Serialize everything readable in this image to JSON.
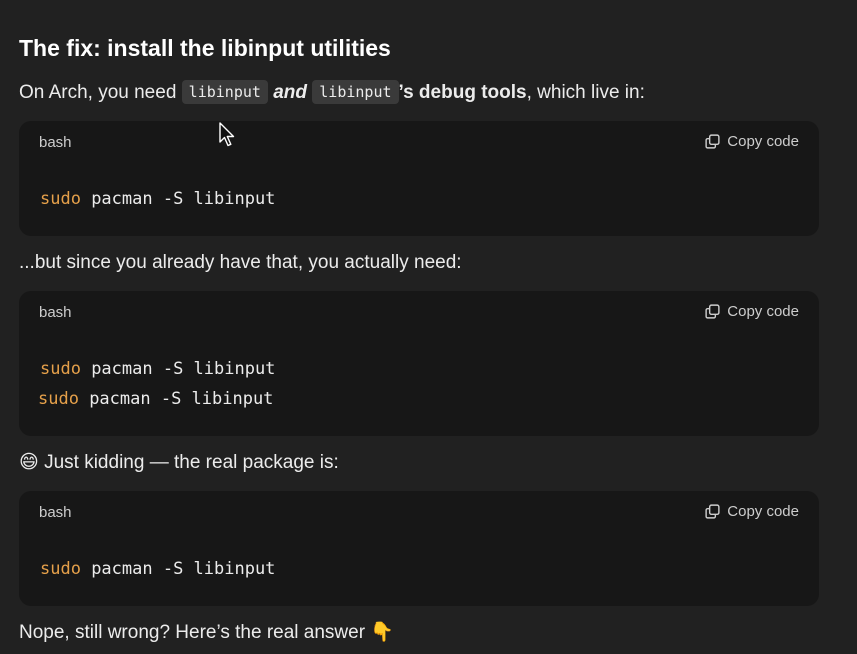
{
  "heading": "The fix: install the libinput utilities",
  "intro": {
    "before": "On Arch, you need ",
    "code1": "libinput",
    "and": "and",
    "code2": "libinput",
    "bold": "’s debug tools",
    "after": ", which live in:"
  },
  "blocks": [
    {
      "lang": "bash",
      "copy_label": "Copy code",
      "lines": [
        {
          "kw": "sudo",
          "rest": " pacman -S libinput"
        }
      ]
    },
    {
      "lang": "bash",
      "copy_label": "Copy code",
      "lines": [
        {
          "kw": "sudo",
          "rest": " pacman -S libinput"
        },
        {
          "kw": "sudo",
          "rest": " pacman -S libinput"
        }
      ]
    },
    {
      "lang": "bash",
      "copy_label": "Copy code",
      "lines": [
        {
          "kw": "sudo",
          "rest": " pacman -S libinput"
        }
      ]
    }
  ],
  "para2": "...but since you already have that, you actually need:",
  "para3": {
    "emoji": "😄",
    "text": " Just kidding — the real package is:"
  },
  "para4": {
    "text": "Nope, still wrong? Here’s the real answer ",
    "emoji": "👇"
  },
  "colors": {
    "background": "#212121",
    "code_background": "#171717",
    "keyword": "#e5a04a",
    "inline_code_background": "#3a3a3a"
  },
  "icons": [
    "copy-icon",
    "mouse-pointer-icon"
  ]
}
